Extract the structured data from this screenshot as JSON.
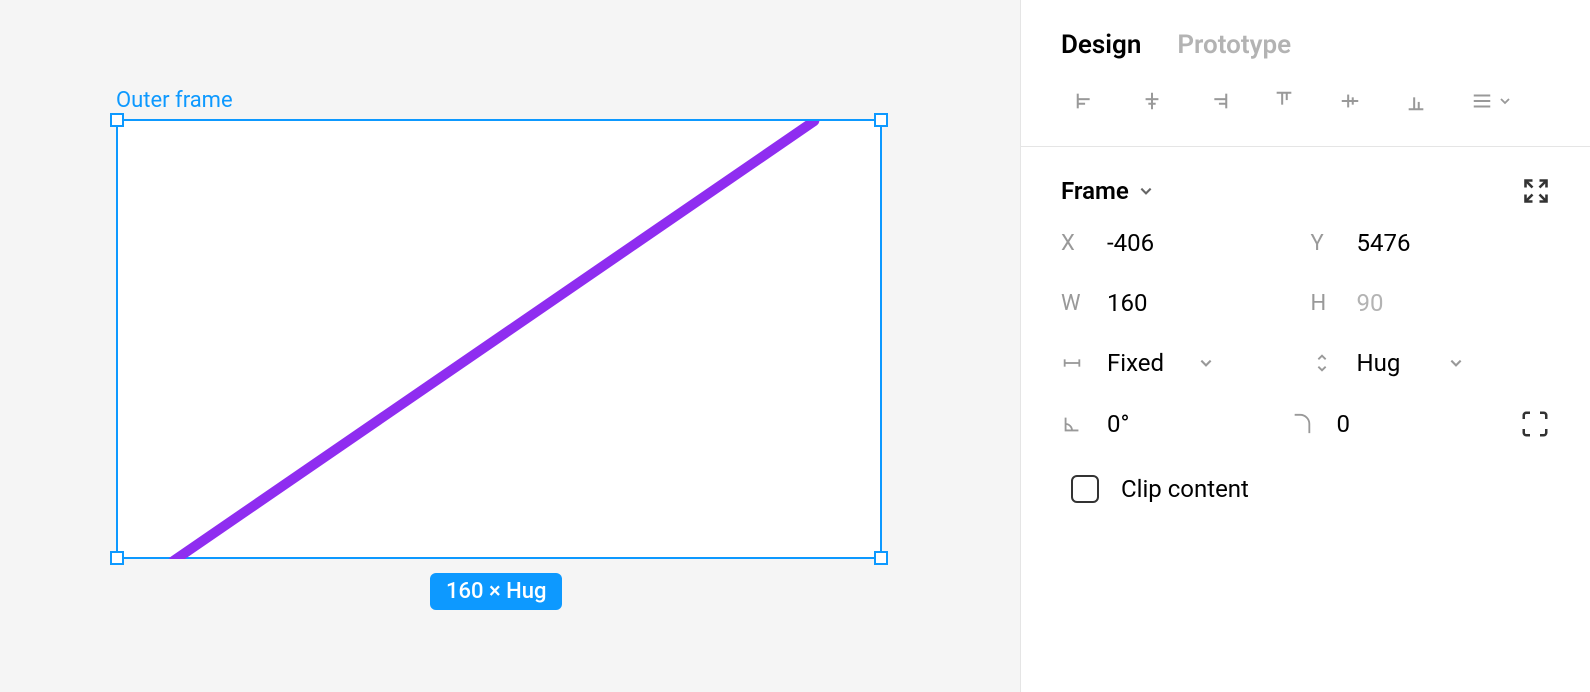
{
  "canvas": {
    "frame_label": "Outer frame",
    "dimension_badge": "160 × Hug",
    "stroke_color": "#8f2df0"
  },
  "tabs": {
    "design": "Design",
    "prototype": "Prototype",
    "active": "design"
  },
  "section": {
    "title": "Frame"
  },
  "props": {
    "x_label": "X",
    "x": "-406",
    "y_label": "Y",
    "y": "5476",
    "w_label": "W",
    "w": "160",
    "h_label": "H",
    "h": "90",
    "w_mode": "Fixed",
    "h_mode": "Hug",
    "rotation": "0°",
    "radius": "0"
  },
  "clip": {
    "label": "Clip content",
    "checked": false
  }
}
